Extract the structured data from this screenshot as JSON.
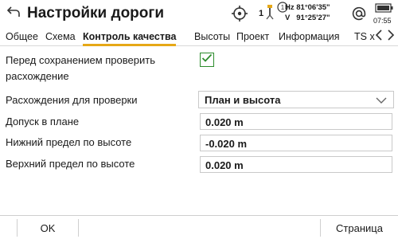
{
  "header": {
    "title": "Настройки дороги",
    "sat_count": "1",
    "badge_number": "1",
    "hz_label": "Hz",
    "hz_value": "81°06'35\"",
    "v_label": "V",
    "v_value": "91°25'27\"",
    "clock": "07:55",
    "icons": [
      "back-arrow-icon",
      "target-icon",
      "satellite-icon",
      "prism-person-icon",
      "reflector-icon",
      "at-sign-icon",
      "battery-icon"
    ]
  },
  "tabs": [
    {
      "label": "Общее",
      "active": false
    },
    {
      "label": "Схема",
      "active": false
    },
    {
      "label": "Контроль качества",
      "active": true
    },
    {
      "label": "Высоты",
      "active": false
    },
    {
      "label": "Проект",
      "active": false
    },
    {
      "label": "Информация",
      "active": false
    },
    {
      "label": "TS x",
      "active": false
    }
  ],
  "form": {
    "check_before_save": {
      "label_line1": "Перед сохранением проверить",
      "label_line2": "расхождение",
      "checked": true
    },
    "check_type": {
      "label": "Расхождения для проверки",
      "value": "План и высота"
    },
    "plan_tolerance": {
      "label": "Допуск в плане",
      "value": "0.020 m"
    },
    "lower_height_limit": {
      "label": "Нижний предел по высоте",
      "value": "-0.020 m"
    },
    "upper_height_limit": {
      "label": "Верхний предел по высоте",
      "value": "0.020 m"
    }
  },
  "footer": {
    "ok_label": "OK",
    "page_label": "Страница"
  },
  "colors": {
    "accent": "#e6a817",
    "checkbox_green": "#2d8c2d",
    "text": "#1a1a1a"
  }
}
